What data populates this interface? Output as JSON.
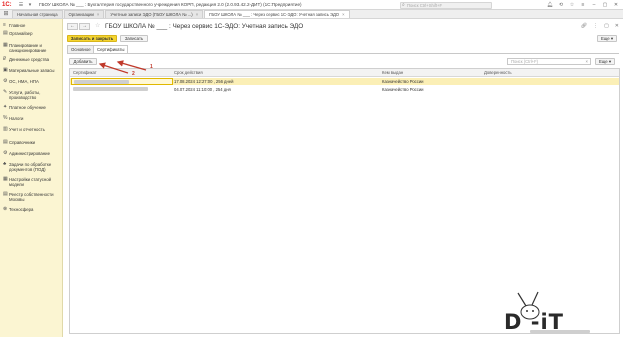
{
  "titlebar": {
    "app_title": "ГБОУ ШКОЛА № ___ : Бухгалтерия государственного учреждения КОРП, редакция 2.0 (2.0.93.42.2-ДИТ) (1С:Предприятие)",
    "search_placeholder": "Поиск Ctrl+Shift+F"
  },
  "window_tabs": [
    {
      "label": "Начальная страница"
    },
    {
      "label": "Организации"
    },
    {
      "label": "Учетные записи ЭДО (ГБОУ ШКОЛА № ...)"
    },
    {
      "label": "ГБОУ ШКОЛА № ___ : Через сервис 1С-ЭДО: Учетная запись ЭДО"
    }
  ],
  "sidebar": {
    "items": [
      {
        "icon": "menu-icon",
        "label": "Главное"
      },
      {
        "icon": "chart-icon",
        "label": "Органайзер"
      },
      {
        "icon": "planning-icon",
        "label": "Планирование и санкционирование"
      },
      {
        "icon": "money-icon",
        "label": "Денежные средства"
      },
      {
        "icon": "box-icon",
        "label": "Материальные запасы"
      },
      {
        "icon": "asset-icon",
        "label": "ОС, НМА, НПА"
      },
      {
        "icon": "services-icon",
        "label": "Услуги, работы, производство"
      },
      {
        "icon": "tuition-icon",
        "label": "Платное обучение"
      },
      {
        "icon": "taxes-icon",
        "label": "Налоги"
      },
      {
        "icon": "reports-icon",
        "label": "Учет и отчетность"
      },
      {
        "icon": "reference-icon",
        "label": "Справочники"
      },
      {
        "icon": "admin-icon",
        "label": "Администрирование"
      },
      {
        "icon": "tasks-icon",
        "label": "Задачи по обработке документов (ПОД)"
      },
      {
        "icon": "settings-icon",
        "label": "Настройки статусной модели"
      },
      {
        "icon": "registry-icon",
        "label": "Реестр собственности Москвы"
      },
      {
        "icon": "tech-icon",
        "label": "Техносфера"
      }
    ]
  },
  "document": {
    "title": "ГБОУ ШКОЛА № ___ : Через сервис 1С-ЭДО: Учетная запись ЭДО",
    "save_close_label": "Записать и закрыть",
    "save_label": "Записать",
    "more_label": "Еще",
    "tabs": [
      {
        "label": "Основное"
      },
      {
        "label": "Сертификаты"
      }
    ]
  },
  "certificates": {
    "add_label": "Добавить",
    "search_placeholder": "Поиск (Ctrl+F)",
    "more_label": "Еще",
    "columns": [
      "Сертификат",
      "Срок действия",
      "Кем выдан",
      "Доверенность"
    ],
    "rows": [
      {
        "certificate": "",
        "validity": "17.08.2024 12:27:00 , 256 дней",
        "issuer": "Казначейство России",
        "poa": ""
      },
      {
        "certificate": "",
        "validity": "04.07.2024 11:10:00 , 254 дня",
        "issuer": "Казначейство России",
        "poa": ""
      }
    ]
  },
  "annotations": {
    "label1": "1",
    "label2": "2",
    "color": "#c0392b"
  },
  "watermark": {
    "text": "D   -iT"
  }
}
